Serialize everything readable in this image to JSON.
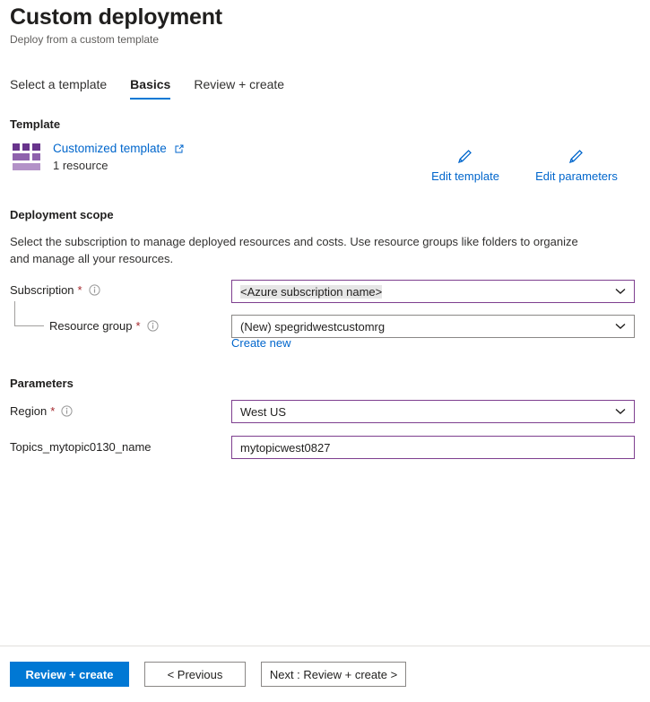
{
  "header": {
    "title": "Custom deployment",
    "subtitle": "Deploy from a custom template"
  },
  "tabs": [
    {
      "label": "Select a template",
      "active": false
    },
    {
      "label": "Basics",
      "active": true
    },
    {
      "label": "Review + create",
      "active": false
    }
  ],
  "template_section": {
    "heading": "Template",
    "icon": "template-grid-icon",
    "link_label": "Customized template",
    "external_link_icon": "external-link-icon",
    "resource_count": "1 resource",
    "actions": [
      {
        "icon": "pencil-icon",
        "label": "Edit template"
      },
      {
        "icon": "pencil-icon",
        "label": "Edit parameters"
      }
    ]
  },
  "deployment_scope": {
    "heading": "Deployment scope",
    "description": "Select the subscription to manage deployed resources and costs. Use resource groups like folders to organize and manage all your resources.",
    "subscription": {
      "label": "Subscription",
      "required_marker": "*",
      "info_icon": "info-circle-icon",
      "value": "<Azure subscription name>",
      "chevron_icon": "chevron-down-icon"
    },
    "resource_group": {
      "label": "Resource group",
      "required_marker": "*",
      "info_icon": "info-circle-icon",
      "value": "(New) spegridwestcustomrg",
      "chevron_icon": "chevron-down-icon",
      "create_new_label": "Create new"
    }
  },
  "parameters_section": {
    "heading": "Parameters",
    "region": {
      "label": "Region",
      "required_marker": "*",
      "info_icon": "info-circle-icon",
      "value": "West US",
      "chevron_icon": "chevron-down-icon"
    },
    "topic_name": {
      "label": "Topics_mytopic0130_name",
      "value": "mytopicwest0827"
    }
  },
  "footer": {
    "review_create": "Review + create",
    "previous": "< Previous",
    "next": "Next : Review + create >"
  },
  "colors": {
    "accent_blue": "#0078d4",
    "link_blue": "#0066cc",
    "required_red": "#a4262c",
    "field_accent_purple": "#7e3f8f",
    "icon_purple_dark": "#68348c",
    "icon_purple_mid": "#8f62ad",
    "icon_purple_light": "#b392c8"
  }
}
